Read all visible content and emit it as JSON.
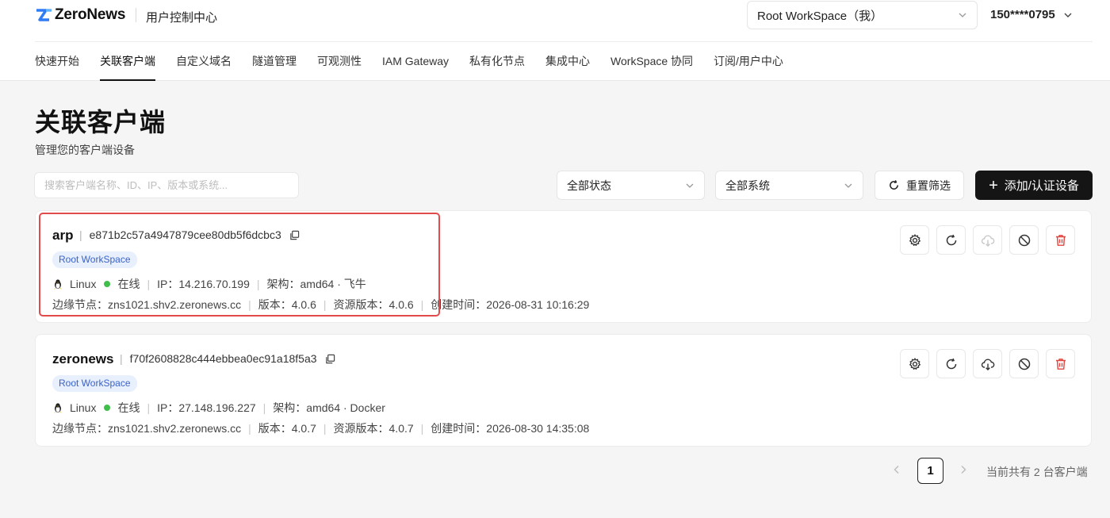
{
  "header": {
    "logo_text": "ZeroNews",
    "console_title": "用户控制中心",
    "workspace_select": "Root WorkSpace（我）",
    "user": "150****0795"
  },
  "nav": {
    "items": [
      {
        "label": "快速开始",
        "active": false
      },
      {
        "label": "关联客户端",
        "active": true
      },
      {
        "label": "自定义域名",
        "active": false
      },
      {
        "label": "隧道管理",
        "active": false
      },
      {
        "label": "可观测性",
        "active": false
      },
      {
        "label": "IAM Gateway",
        "active": false
      },
      {
        "label": "私有化节点",
        "active": false
      },
      {
        "label": "集成中心",
        "active": false
      },
      {
        "label": "WorkSpace 协同",
        "active": false
      },
      {
        "label": "订阅/用户中心",
        "active": false
      }
    ]
  },
  "page": {
    "title": "关联客户端",
    "subtitle": "管理您的客户端设备"
  },
  "filters": {
    "search_placeholder": "搜索客户端名称、ID、IP、版本或系统...",
    "search_value": "",
    "status_select": "全部状态",
    "system_select": "全部系统",
    "reset_label": "重置筛选",
    "add_label": "添加/认证设备"
  },
  "clients": [
    {
      "name": "arp",
      "id": "e871b2c57a4947879cee80db5f6dcbc3",
      "tag": "Root WorkSpace",
      "os": "Linux",
      "status": "在线",
      "ip": "IP：14.216.70.199",
      "arch": "架构：amd64 · 飞牛",
      "edge": "边缘节点：zns1021.shv2.zeronews.cc",
      "version": "版本：4.0.6",
      "resource_version": "资源版本：4.0.6",
      "created": "创建时间：2026-08-31 10:16:29",
      "download_enabled": false
    },
    {
      "name": "zeronews",
      "id": "f70f2608828c444ebbea0ec91a18f5a3",
      "tag": "Root WorkSpace",
      "os": "Linux",
      "status": "在线",
      "ip": "IP：27.148.196.227",
      "arch": "架构：amd64 · Docker",
      "edge": "边缘节点：zns1021.shv2.zeronews.cc",
      "version": "版本：4.0.7",
      "resource_version": "资源版本：4.0.7",
      "created": "创建时间：2026-08-30 14:35:08",
      "download_enabled": true
    }
  ],
  "pagination": {
    "current": "1",
    "total_text": "当前共有 2 台客户端"
  },
  "colors": {
    "accent": "#151515",
    "online": "#3fbf4a",
    "tag_bg": "#e8effd",
    "tag_text": "#3a63c9",
    "delete": "#e0453f",
    "highlight": "#e24b4b"
  }
}
